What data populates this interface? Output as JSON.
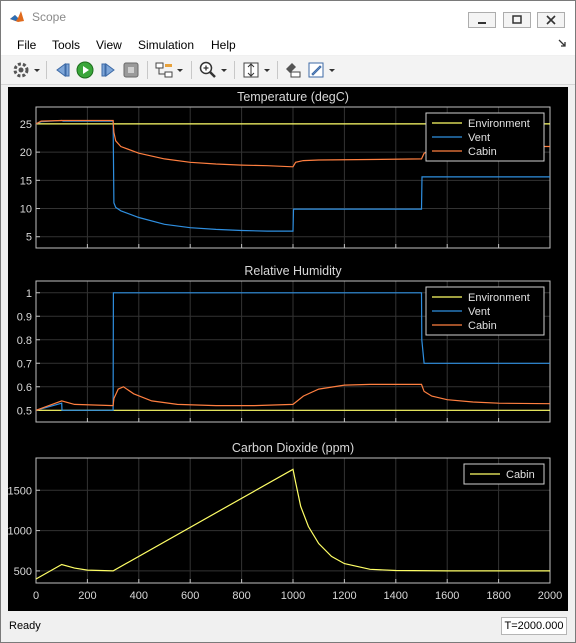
{
  "window": {
    "title": "Scope",
    "icon": "matlab-logo-icon"
  },
  "menubar": {
    "items": [
      "File",
      "Tools",
      "View",
      "Simulation",
      "Help"
    ]
  },
  "toolbar": {
    "icons": [
      "gear-icon",
      "dropdown-arrow-icon",
      "step-back-icon",
      "run-icon",
      "step-forward-icon",
      "stop-icon",
      "signal-hierarchy-icon",
      "dropdown-arrow-icon",
      "zoom-in-icon",
      "dropdown-arrow-icon",
      "scale-axes-icon",
      "dropdown-arrow-icon",
      "highlight-block-icon",
      "edit-style-icon",
      "dropdown-arrow-icon"
    ]
  },
  "status": {
    "left": "Ready",
    "right": "T=2000.000"
  },
  "colors": {
    "environment": "#ffff66",
    "vent": "#2f8fe0",
    "cabin": "#ff7f40",
    "background": "#000000",
    "axes": "#c0c0c0",
    "grid": "#333333"
  },
  "chart_data": [
    {
      "type": "line",
      "title": "Temperature (degC)",
      "xlim": [
        0,
        2000
      ],
      "ylim": [
        3,
        28
      ],
      "yticks": [
        5,
        10,
        15,
        20,
        25
      ],
      "grid": true,
      "legend": "top-right",
      "series": [
        {
          "name": "Environment",
          "color": "#ffff66",
          "x": [
            0,
            2000
          ],
          "y": [
            25,
            25
          ]
        },
        {
          "name": "Vent",
          "color": "#2f8fe0",
          "x": [
            0,
            20,
            100,
            105,
            300,
            303,
            310,
            330,
            400,
            500,
            600,
            700,
            800,
            900,
            1000,
            1002,
            1500,
            1502,
            2000
          ],
          "y": [
            25,
            25.4,
            25.6,
            25.5,
            25.5,
            11,
            10.2,
            9.6,
            8.4,
            7.2,
            6.6,
            6.3,
            6.1,
            6.0,
            6.0,
            9.9,
            9.9,
            15.6,
            15.6
          ]
        },
        {
          "name": "Cabin",
          "color": "#ff7f40",
          "x": [
            0,
            20,
            100,
            300,
            303,
            310,
            330,
            400,
            500,
            600,
            700,
            800,
            900,
            1000,
            1010,
            1040,
            1100,
            1300,
            1500,
            1510,
            1550,
            1700,
            1800,
            1900,
            2000
          ],
          "y": [
            25,
            25.5,
            25.6,
            25.6,
            23.5,
            22.0,
            21.0,
            19.8,
            18.8,
            18.2,
            17.9,
            17.7,
            17.6,
            17.4,
            18.2,
            18.5,
            18.6,
            18.7,
            18.8,
            19.8,
            20.6,
            20.9,
            21.0,
            21.0,
            21.0
          ]
        }
      ]
    },
    {
      "type": "line",
      "title": "Relative Humidity",
      "xlim": [
        0,
        2000
      ],
      "ylim": [
        0.45,
        1.05
      ],
      "yticks": [
        0.5,
        0.6,
        0.7,
        0.8,
        0.9,
        1
      ],
      "ytick_labels": [
        "0.5",
        "0.6",
        "0.7",
        "0.8",
        "0.9",
        "1"
      ],
      "grid": true,
      "legend": "top-right",
      "series": [
        {
          "name": "Environment",
          "color": "#ffff66",
          "x": [
            0,
            2000
          ],
          "y": [
            0.5,
            0.5
          ]
        },
        {
          "name": "Vent",
          "color": "#2f8fe0",
          "x": [
            0,
            100,
            101,
            300,
            301,
            1500,
            1501,
            1510,
            2000
          ],
          "y": [
            0.5,
            0.53,
            0.5,
            0.5,
            1.0,
            1.0,
            0.8,
            0.7,
            0.7
          ]
        },
        {
          "name": "Cabin",
          "color": "#ff7f40",
          "x": [
            0,
            50,
            100,
            150,
            300,
            303,
            320,
            340,
            380,
            450,
            550,
            700,
            850,
            1000,
            1040,
            1100,
            1200,
            1300,
            1400,
            1500,
            1510,
            1540,
            1600,
            1700,
            1800,
            2000
          ],
          "y": [
            0.5,
            0.52,
            0.54,
            0.525,
            0.52,
            0.55,
            0.59,
            0.6,
            0.57,
            0.54,
            0.525,
            0.52,
            0.52,
            0.525,
            0.56,
            0.59,
            0.607,
            0.61,
            0.61,
            0.61,
            0.58,
            0.56,
            0.545,
            0.535,
            0.53,
            0.528
          ]
        }
      ]
    },
    {
      "type": "line",
      "title": "Carbon Dioxide (ppm)",
      "xlim": [
        0,
        2000
      ],
      "ylim": [
        350,
        1900
      ],
      "yticks": [
        500,
        1000,
        1500
      ],
      "xticks": [
        0,
        200,
        400,
        600,
        800,
        1000,
        1200,
        1400,
        1600,
        1800,
        2000
      ],
      "xlabel": "",
      "grid": true,
      "legend": "top-right",
      "series": [
        {
          "name": "Cabin",
          "color": "#ffff66",
          "x": [
            0,
            100,
            150,
            200,
            300,
            1000,
            1010,
            1030,
            1060,
            1100,
            1150,
            1200,
            1300,
            1400,
            1600,
            2000
          ],
          "y": [
            400,
            580,
            535,
            510,
            500,
            1760,
            1600,
            1300,
            1050,
            840,
            680,
            590,
            520,
            505,
            500,
            500
          ]
        }
      ]
    }
  ]
}
